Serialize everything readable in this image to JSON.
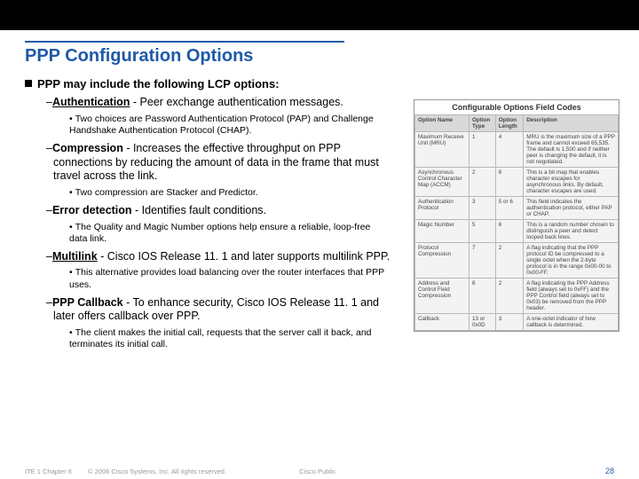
{
  "title": "PPP Configuration Options",
  "intro": "PPP may include the following LCP options:",
  "options": [
    {
      "name": "Authentication",
      "underline": true,
      "desc": " - Peer exchange authentication messages.",
      "sub": "Two choices are Password Authentication Protocol (PAP) and Challenge Handshake Authentication Protocol (CHAP)."
    },
    {
      "name": "Compression",
      "underline": false,
      "desc": " - Increases the effective throughput on PPP connections by reducing the amount of data in the frame that must travel across the link.",
      "sub": "Two compression are Stacker and Predictor."
    },
    {
      "name": "Error detection",
      "underline": false,
      "desc": " - Identifies fault conditions.",
      "sub": "The Quality and Magic Number options help ensure a reliable, loop-free data link."
    },
    {
      "name": "Multilink",
      "underline": true,
      "desc": " - Cisco IOS Release 11. 1 and later supports multilink PPP.",
      "sub": "This alternative provides load balancing over the router interfaces that PPP uses."
    },
    {
      "name": "PPP Callback",
      "underline": false,
      "desc": " - To enhance security, Cisco IOS Release 11. 1 and later offers callback over PPP.",
      "sub": "The client makes the initial call, requests that the server call it back, and terminates its initial call."
    }
  ],
  "figure": {
    "title": "Configurable Options Field Codes",
    "headers": [
      "Option Name",
      "Option Type",
      "Option Length",
      "Description"
    ],
    "rows": [
      [
        "Maximum Receive Unit (MRU)",
        "1",
        "4",
        "MRU is the maximum size of a PPP frame and cannot exceed 65,535. The default is 1,500 and if neither peer is changing the default, it is not negotiated."
      ],
      [
        "Asynchronous Control Character Map (ACCM)",
        "2",
        "6",
        "This is a bit map that enables character escapes for asynchronous links. By default, character escapes are used."
      ],
      [
        "Authentication Protocol",
        "3",
        "5 or 6",
        "This field indicates the authentication protocol, either PAP or CHAP."
      ],
      [
        "Magic Number",
        "5",
        "6",
        "This is a random number chosen to distinguish a peer and detect looped back lines."
      ],
      [
        "Protocol Compression",
        "7",
        "2",
        "A flag indicating that the PPP protocol ID be compressed to a single octet when the 2-byte protocol is in the range 0x00-00 to 0x00-FF."
      ],
      [
        "Address and Control Field Compression",
        "8",
        "2",
        "A flag indicating the PPP Address field (always set to 0xFF) and the PPP Control field (always set to 0x03) be removed from the PPP header."
      ],
      [
        "Callback",
        "13 or 0x0D",
        "3",
        "A one-octet indicator of how callback is determined."
      ]
    ]
  },
  "footer": {
    "chapter": "ITE 1 Chapter 6",
    "copyright": "© 2006 Cisco Systems, Inc. All rights reserved.",
    "right_label": "Cisco Public",
    "page": "28"
  }
}
